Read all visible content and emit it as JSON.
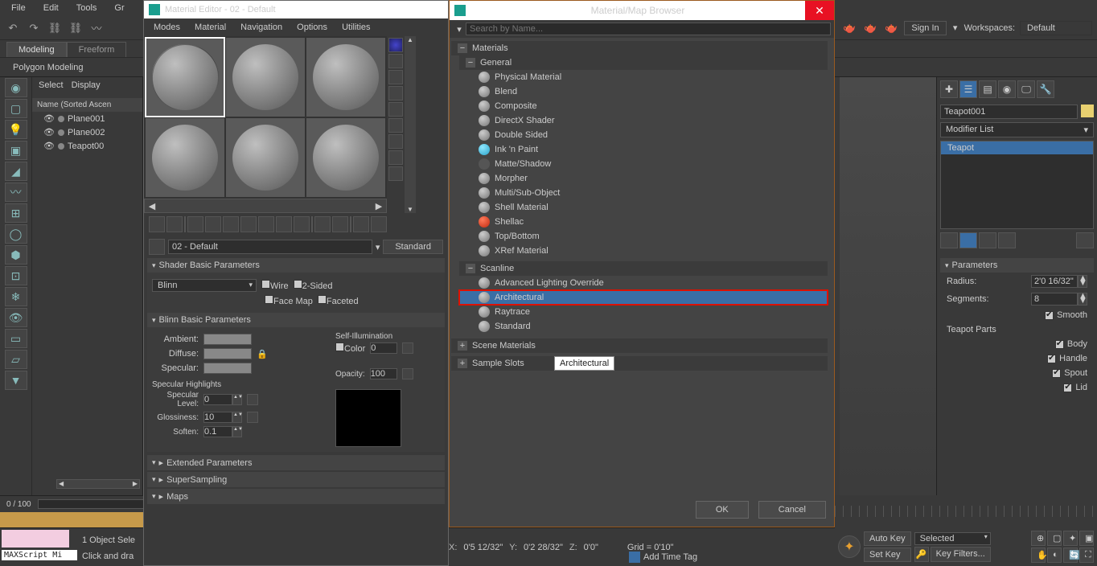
{
  "main_menu": [
    "File",
    "Edit",
    "Tools",
    "Gr"
  ],
  "top_items": {
    "signin": "Sign In",
    "ws_lbl": "Workspaces:",
    "ws_val": "Default"
  },
  "tabs": {
    "modeling": "Modeling",
    "freeform": "Freeform",
    "poly": "Polygon Modeling"
  },
  "explorer": {
    "select": "Select",
    "display": "Display",
    "hdr": "Name (Sorted Ascen",
    "items": [
      "Plane001",
      "Plane002",
      "Teapot00"
    ]
  },
  "matedit": {
    "title": "Material Editor - 02 - Default",
    "menu": [
      "Modes",
      "Material",
      "Navigation",
      "Options",
      "Utilities"
    ],
    "matname": "02 - Default",
    "typebtn": "Standard",
    "roll_shader": "Shader Basic Parameters",
    "shading": "Blinn",
    "wire": "Wire",
    "twosided": "2-Sided",
    "facemap": "Face Map",
    "faceted": "Faceted",
    "roll_blinn": "Blinn Basic Parameters",
    "ambient": "Ambient:",
    "diffuse": "Diffuse:",
    "specular": "Specular:",
    "selfillum": "Self-Illumination",
    "color": "Color",
    "color_v": "0",
    "opacity": "Opacity:",
    "opacity_v": "100",
    "spechl": "Specular Highlights",
    "speclvl": "Specular Level:",
    "speclvl_v": "0",
    "gloss": "Glossiness:",
    "gloss_v": "10",
    "soften": "Soften:",
    "soften_v": "0.1",
    "roll_ext": "Extended Parameters",
    "roll_ss": "SuperSampling",
    "roll_maps": "Maps"
  },
  "browser": {
    "title": "Material/Map Browser",
    "materials": "Materials",
    "general": "General",
    "scanline": "Scanline",
    "scene": "Scene Materials",
    "sample": "Sample Slots",
    "gen_items": [
      "Physical Material",
      "Blend",
      "Composite",
      "DirectX Shader",
      "Double Sided",
      "Ink 'n Paint",
      "Matte/Shadow",
      "Morpher",
      "Multi/Sub-Object",
      "Shell Material",
      "Shellac",
      "Top/Bottom",
      "XRef Material"
    ],
    "scan_items": [
      "Advanced Lighting Override",
      "Architectural",
      "Raytrace",
      "Standard"
    ],
    "tooltip": "Architectural",
    "ok": "OK",
    "cancel": "Cancel"
  },
  "right": {
    "objname": "Teapot001",
    "modlist": "Modifier List",
    "stack_sel": "Teapot",
    "parameters": "Parameters",
    "radius": "Radius:",
    "radius_v": "2'0 16/32\"",
    "seg": "Segments:",
    "seg_v": "8",
    "smooth": "Smooth",
    "parts": "Teapot Parts",
    "body": "Body",
    "handle": "Handle",
    "spout": "Spout",
    "lid": "Lid"
  },
  "status": {
    "x": "X:",
    "xv": "0'5 12/32\"",
    "y": "Y:",
    "yv": "0'2 28/32\"",
    "z": "Z:",
    "zv": "0'0\"",
    "grid": "Grid = 0'10\"",
    "addtag": "Add Time Tag",
    "frames": "0 / 100"
  },
  "bot": {
    "sel": "1 Object Sele",
    "click": "Click and dra",
    "ms": "MAXScript Mi",
    "autokey": "Auto Key",
    "setkey": "Set Key",
    "selected": "Selected",
    "keyfilt": "Key Filters..."
  },
  "hints": {
    "search": "Search by Name..."
  }
}
